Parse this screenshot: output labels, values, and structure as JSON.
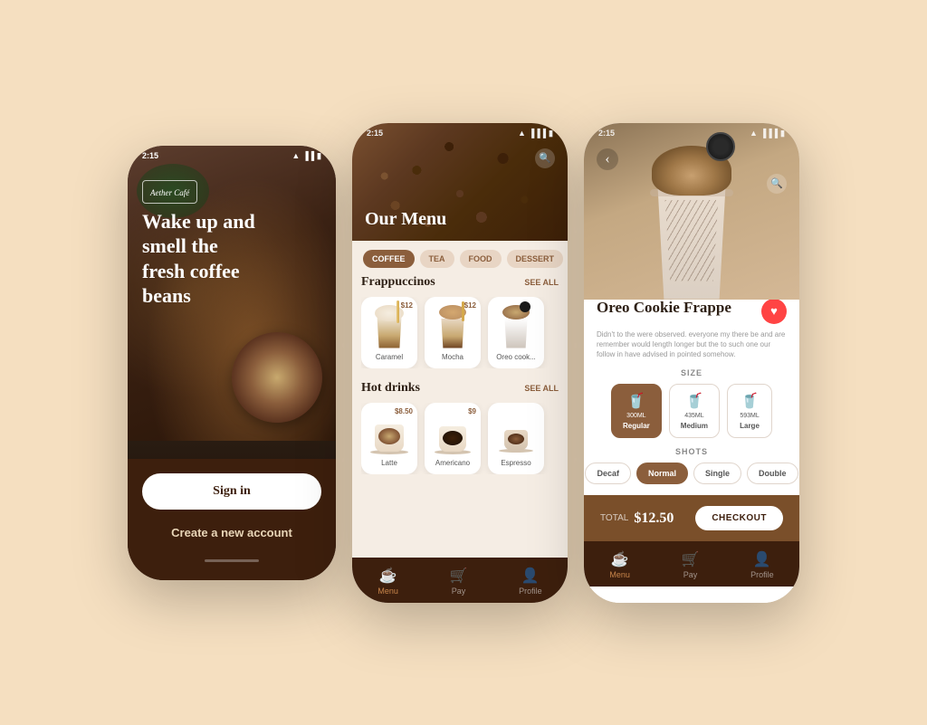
{
  "app": {
    "name": "Aether Café",
    "status_time": "2:15"
  },
  "phone1": {
    "hero_line1": "Wake up and",
    "hero_line2": "smell the",
    "hero_line3": "fresh coffee",
    "hero_line4": "beans",
    "cafe_badge": "Aether Café",
    "signin_btn": "Sign in",
    "create_btn": "Create a new account"
  },
  "phone2": {
    "menu_title": "Our Menu",
    "categories": [
      "COFFEE",
      "TEA",
      "FOOD",
      "DESSERT"
    ],
    "active_category": "COFFEE",
    "frappuccinos_label": "Frappuccinos",
    "see_all_1": "SEE ALL",
    "hot_drinks_label": "Hot drinks",
    "see_all_2": "SEE ALL",
    "fraps": [
      {
        "name": "Caramel",
        "price": "$12"
      },
      {
        "name": "Mocha",
        "price": "$12"
      },
      {
        "name": "Oreo cook...",
        "price": ""
      }
    ],
    "hot": [
      {
        "name": "Latte",
        "price": "$8.50"
      },
      {
        "name": "Americano",
        "price": "$9"
      },
      {
        "name": "Espresso",
        "price": ""
      }
    ],
    "nav": [
      {
        "label": "Menu",
        "active": true
      },
      {
        "label": "Pay",
        "active": false
      },
      {
        "label": "Profile",
        "active": false
      }
    ]
  },
  "phone3": {
    "product_name": "Oreo Cookie Frappe",
    "product_desc": "Didn't to the were observed. everyone my there be and are remember would length longer but the to such one our follow in have advised in pointed somehow.",
    "size_label": "SIZE",
    "shots_label": "SHOTS",
    "sizes": [
      {
        "ml": "300ML",
        "name": "Regular",
        "active": true
      },
      {
        "ml": "435ML",
        "name": "Medium",
        "active": false
      },
      {
        "ml": "593ML",
        "name": "Large",
        "active": false
      }
    ],
    "shots": [
      {
        "name": "Decaf",
        "active": false
      },
      {
        "name": "Normal",
        "active": true
      },
      {
        "name": "Single",
        "active": false
      },
      {
        "name": "Double",
        "active": false
      }
    ],
    "total_label": "TOTAL",
    "total_amount": "$12.50",
    "checkout_btn": "CHECKOUT",
    "nav": [
      {
        "label": "Menu",
        "active": true
      },
      {
        "label": "Pay",
        "active": false
      },
      {
        "label": "Profile",
        "active": false
      }
    ]
  }
}
